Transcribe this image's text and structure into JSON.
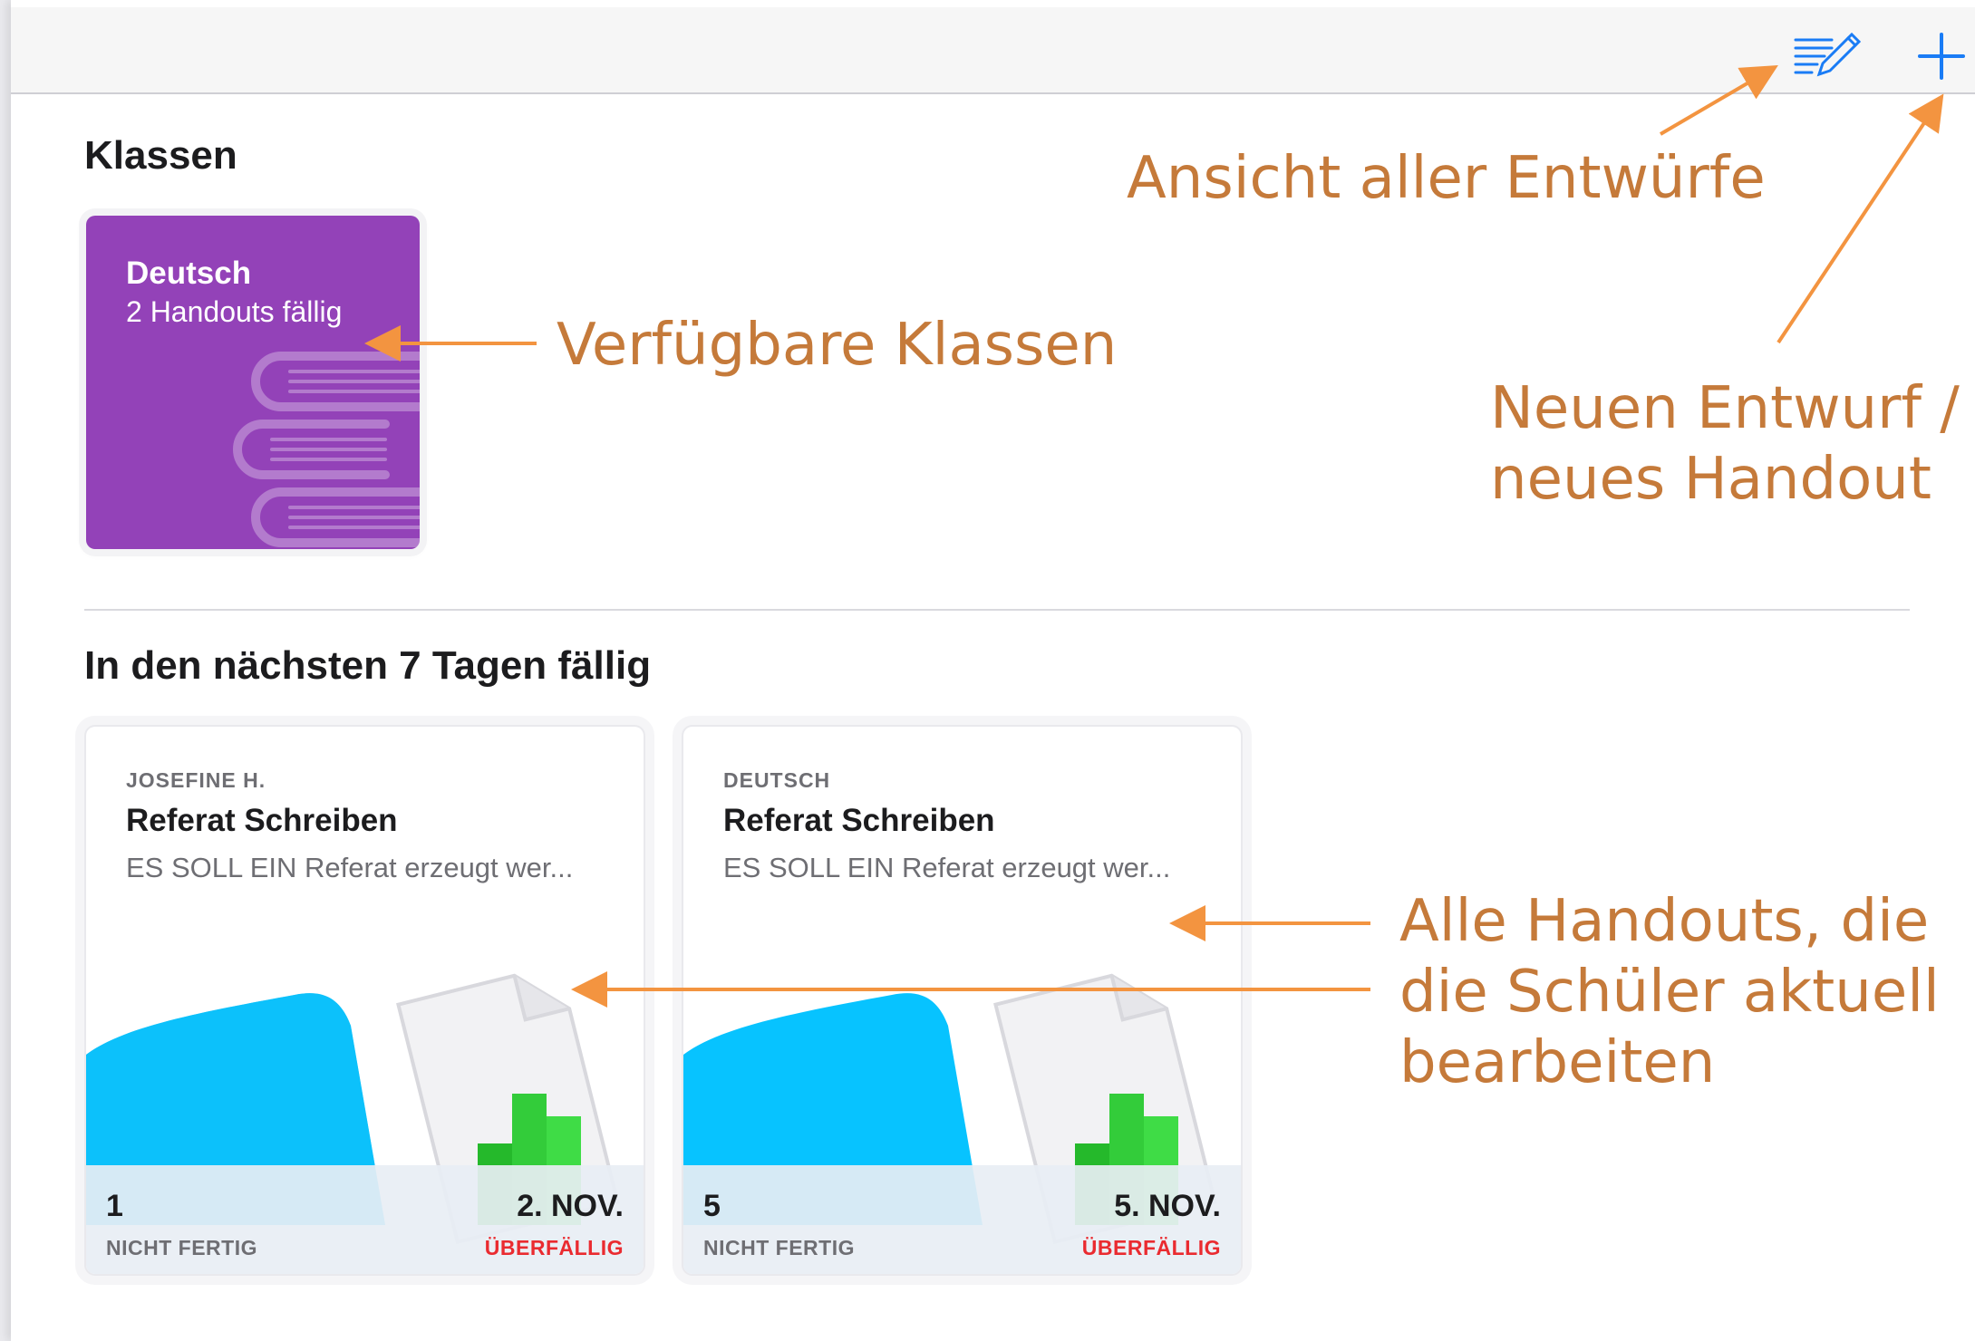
{
  "toolbar": {
    "drafts_icon": "drafts-edit-icon",
    "add_icon": "plus-icon",
    "accent_color": "#1a7cf5"
  },
  "classes_section": {
    "title": "Klassen",
    "items": [
      {
        "name": "Deutsch",
        "subtitle": "2 Handouts fällig",
        "color": "#9342b8",
        "icon": "books-icon"
      }
    ]
  },
  "due_section": {
    "title": "In den nächsten 7 Tagen fällig",
    "cards": [
      {
        "owner": "JOSEFINE H.",
        "title": "Referat Schreiben",
        "description": "ES SOLL EIN Referat erzeugt wer...",
        "count": "1",
        "status": "NICHT FERTIG",
        "date": "2. NOV.",
        "due_status": "ÜBERFÄLLIG",
        "icon": "numbers-document-icon"
      },
      {
        "owner": "DEUTSCH",
        "title": "Referat Schreiben",
        "description": "ES SOLL EIN Referat erzeugt wer...",
        "count": "5",
        "status": "NICHT FERTIG",
        "date": "5. NOV.",
        "due_status": "ÜBERFÄLLIG",
        "icon": "numbers-document-icon"
      }
    ]
  },
  "annotations": {
    "drafts": "Ansicht aller Entwürfe",
    "classes": "Verfügbare Klassen",
    "new_line1": "Neuen Entwurf /",
    "new_line2": "neues Handout",
    "handouts_line1": "Alle Handouts, die",
    "handouts_line2": "die Schüler aktuell",
    "handouts_line3": "bearbeiten",
    "color": "#c57a3a",
    "arrow_color": "#f39440"
  }
}
